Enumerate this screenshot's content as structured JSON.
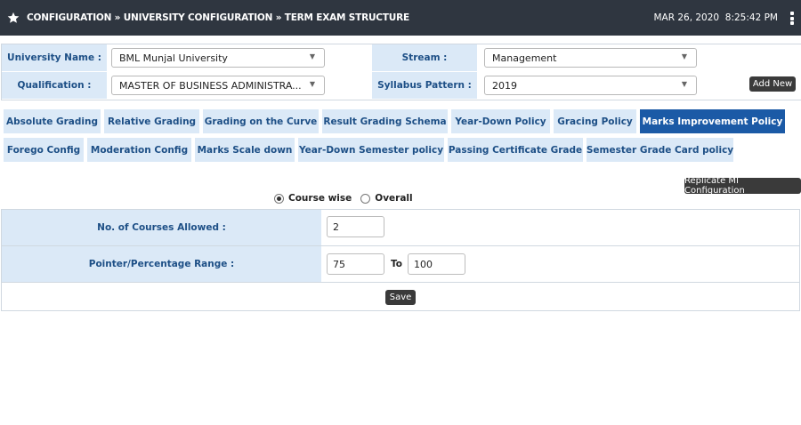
{
  "header": {
    "breadcrumb": "CONFIGURATION » UNIVERSITY CONFIGURATION » TERM EXAM STRUCTURE",
    "date": "MAR 26, 2020",
    "time": "8:25:42 PM"
  },
  "filters": {
    "university_label": "University Name :",
    "university_value": "BML Munjal University",
    "qualification_label": "Qualification :",
    "qualification_value": "MASTER OF BUSINESS ADMINISTRA...",
    "stream_label": "Stream :",
    "stream_value": "Management",
    "syllabus_label": "Syllabus Pattern :",
    "syllabus_value": "2019",
    "add_new": "Add New"
  },
  "tabs_row1": [
    "Absolute Grading",
    "Relative Grading",
    "Grading on the Curve",
    "Result Grading Schema",
    "Year-Down Policy",
    "Gracing Policy",
    "Marks Improvement Policy"
  ],
  "tabs_row2": [
    "Forego Config",
    "Moderation Config",
    "Marks Scale down",
    "Year-Down Semester policy",
    "Passing Certificate Grade",
    "Semester Grade Card policy"
  ],
  "active_tab": "Marks Improvement Policy",
  "replicate_button": "Replicate MI Configuration",
  "mode": {
    "option1": "Course wise",
    "option2": "Overall",
    "selected": "Course wise"
  },
  "form": {
    "courses_label": "No. of Courses Allowed :",
    "courses_value": "2",
    "range_label": "Pointer/Percentage Range :",
    "range_from": "75",
    "range_to_label": "To",
    "range_to": "100",
    "save": "Save"
  }
}
